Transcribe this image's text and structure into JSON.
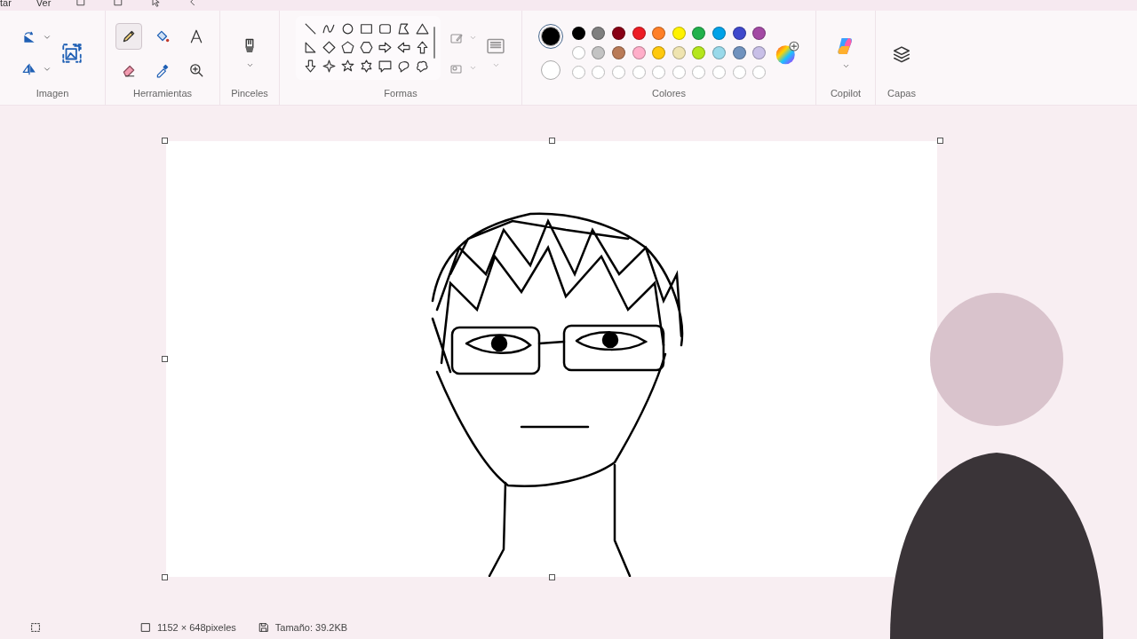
{
  "menu": [
    "tar",
    "Ver"
  ],
  "ribbon": {
    "groups": [
      {
        "label": "Imagen"
      },
      {
        "label": "Herramientas"
      },
      {
        "label": "Pinceles"
      },
      {
        "label": "Formas"
      },
      {
        "label": "Colores"
      },
      {
        "label": "Copilot"
      },
      {
        "label": "Capas"
      }
    ]
  },
  "tools": [
    {
      "kind": "pencil",
      "selected": true
    },
    {
      "kind": "fill",
      "selected": false
    },
    {
      "kind": "text",
      "selected": false
    },
    {
      "kind": "eraser",
      "selected": false
    },
    {
      "kind": "picker",
      "selected": false
    },
    {
      "kind": "zoom",
      "selected": false
    }
  ],
  "shapes": [
    {
      "kind": "line"
    },
    {
      "kind": "curve"
    },
    {
      "kind": "oval"
    },
    {
      "kind": "rect"
    },
    {
      "kind": "rounded-rect"
    },
    {
      "kind": "polygon"
    },
    {
      "kind": "triangle"
    },
    {
      "kind": "right-triangle"
    },
    {
      "kind": "diamond"
    },
    {
      "kind": "pentagon"
    },
    {
      "kind": "hexagon"
    },
    {
      "kind": "arrow-right"
    },
    {
      "kind": "arrow-left"
    },
    {
      "kind": "arrow-up"
    },
    {
      "kind": "arrow-down"
    },
    {
      "kind": "star4"
    },
    {
      "kind": "star5"
    },
    {
      "kind": "star6"
    },
    {
      "kind": "callout-rect"
    },
    {
      "kind": "callout-oval"
    },
    {
      "kind": "callout-cloud"
    }
  ],
  "current_colors": [
    {
      "color": "#000000",
      "selected": true
    },
    {
      "color": "#ffffff",
      "selected": false
    }
  ],
  "palette": [
    [
      {
        "color": "#000000"
      },
      {
        "color": "#7f7f7f"
      },
      {
        "color": "#880015"
      },
      {
        "color": "#ed1c24"
      },
      {
        "color": "#ff7f27"
      },
      {
        "color": "#fff200"
      },
      {
        "color": "#22b14c"
      },
      {
        "color": "#00a2e8"
      },
      {
        "color": "#3f48cc"
      },
      {
        "color": "#a349a4"
      }
    ],
    [
      {
        "color": "#ffffff"
      },
      {
        "color": "#c3c3c3"
      },
      {
        "color": "#b97a57"
      },
      {
        "color": "#ffaec9"
      },
      {
        "color": "#ffc90e"
      },
      {
        "color": "#efe4b0"
      },
      {
        "color": "#b5e61d"
      },
      {
        "color": "#99d9ea"
      },
      {
        "color": "#7092be"
      },
      {
        "color": "#c8bfe7"
      }
    ],
    [
      {
        "kind": "empty"
      },
      {
        "kind": "empty"
      },
      {
        "kind": "empty"
      },
      {
        "kind": "empty"
      },
      {
        "kind": "empty"
      },
      {
        "kind": "empty"
      },
      {
        "kind": "empty"
      },
      {
        "kind": "empty"
      },
      {
        "kind": "empty"
      },
      {
        "kind": "empty"
      }
    ]
  ],
  "status_bar": {
    "dimensions": "1152 × 648pixeles",
    "size": "Tamaño: 39.2KB"
  }
}
